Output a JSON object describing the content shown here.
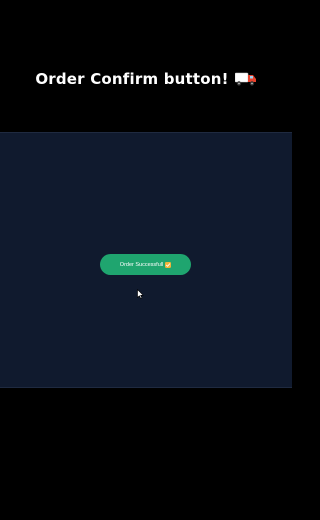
{
  "caption": {
    "text": "Order Confirm button!",
    "icon": "delivery-truck-icon"
  },
  "stage": {
    "background": "#101a2e"
  },
  "order_button": {
    "label": "Order Successfull",
    "status_icon": "check-emoji-icon",
    "color": "#1fa56f"
  },
  "cursor": {
    "icon": "mouse-pointer-icon"
  }
}
